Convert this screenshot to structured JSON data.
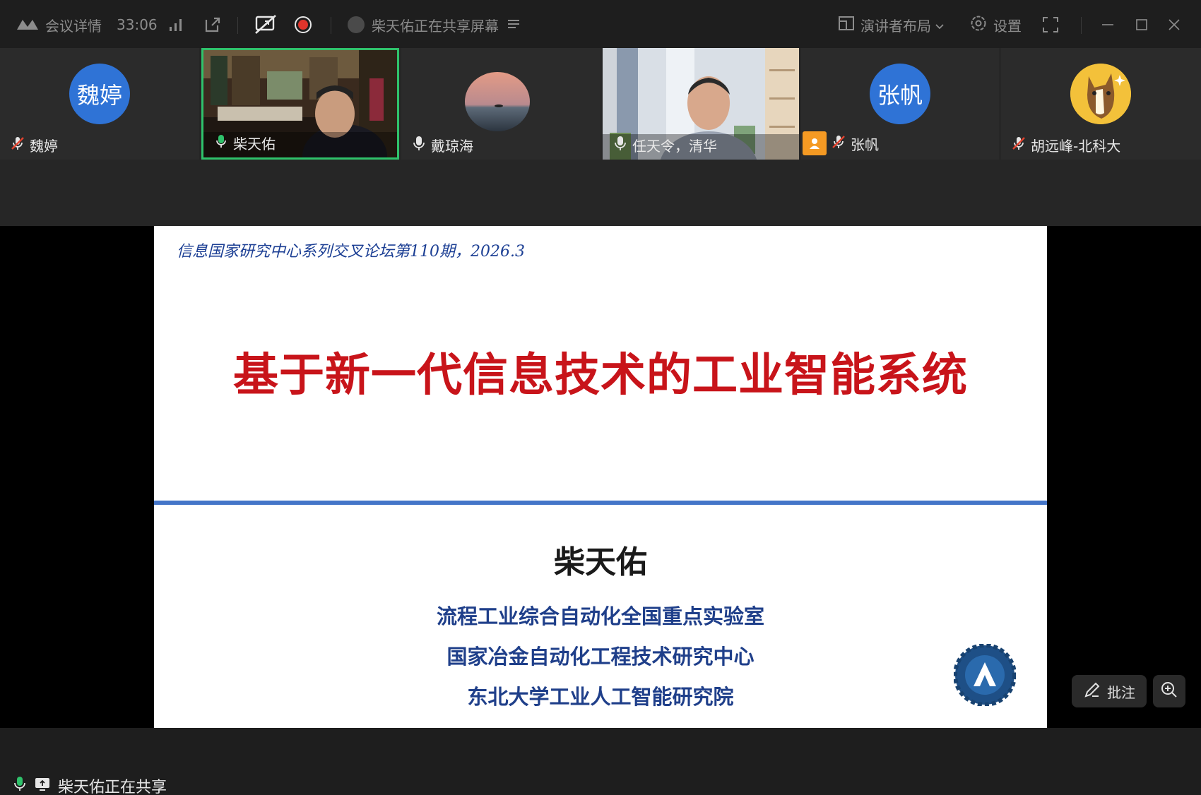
{
  "titlebar": {
    "meeting_details": "会议详情",
    "timer": "33:06",
    "sharing_notice": "柴天佑正在共享屏幕",
    "layout_label": "演讲者布局",
    "settings_label": "设置"
  },
  "participants": [
    {
      "name": "魏婷",
      "avatar_text": "魏婷",
      "mic": "muted"
    },
    {
      "name": "柴天佑",
      "mic": "active",
      "video": true,
      "highlighted": true
    },
    {
      "name": "戴琼海",
      "mic": "on"
    },
    {
      "name": "任天令，清华",
      "mic": "on",
      "video": true
    },
    {
      "name": "张帆",
      "avatar_text": "张帆",
      "mic": "muted"
    },
    {
      "name": "胡远峰-北科大",
      "mic": "muted"
    }
  ],
  "slide": {
    "header": "信息国家研究中心系列交叉论坛第110期，2026.3",
    "title": "基于新一代信息技术的工业智能系统",
    "author": "柴天佑",
    "affiliations": [
      "流程工业综合自动化全国重点实验室",
      "国家冶金自动化工程技术研究中心",
      "东北大学工业人工智能研究院"
    ]
  },
  "controls": {
    "annotate_label": "批注"
  },
  "bottombar": {
    "status": "柴天佑正在共享"
  },
  "colors": {
    "accent_green": "#2fc26b",
    "title_red": "#c8141a",
    "avatar_blue": "#2f73d6",
    "rule_blue": "#4475c8",
    "record_red": "#e0342b"
  }
}
